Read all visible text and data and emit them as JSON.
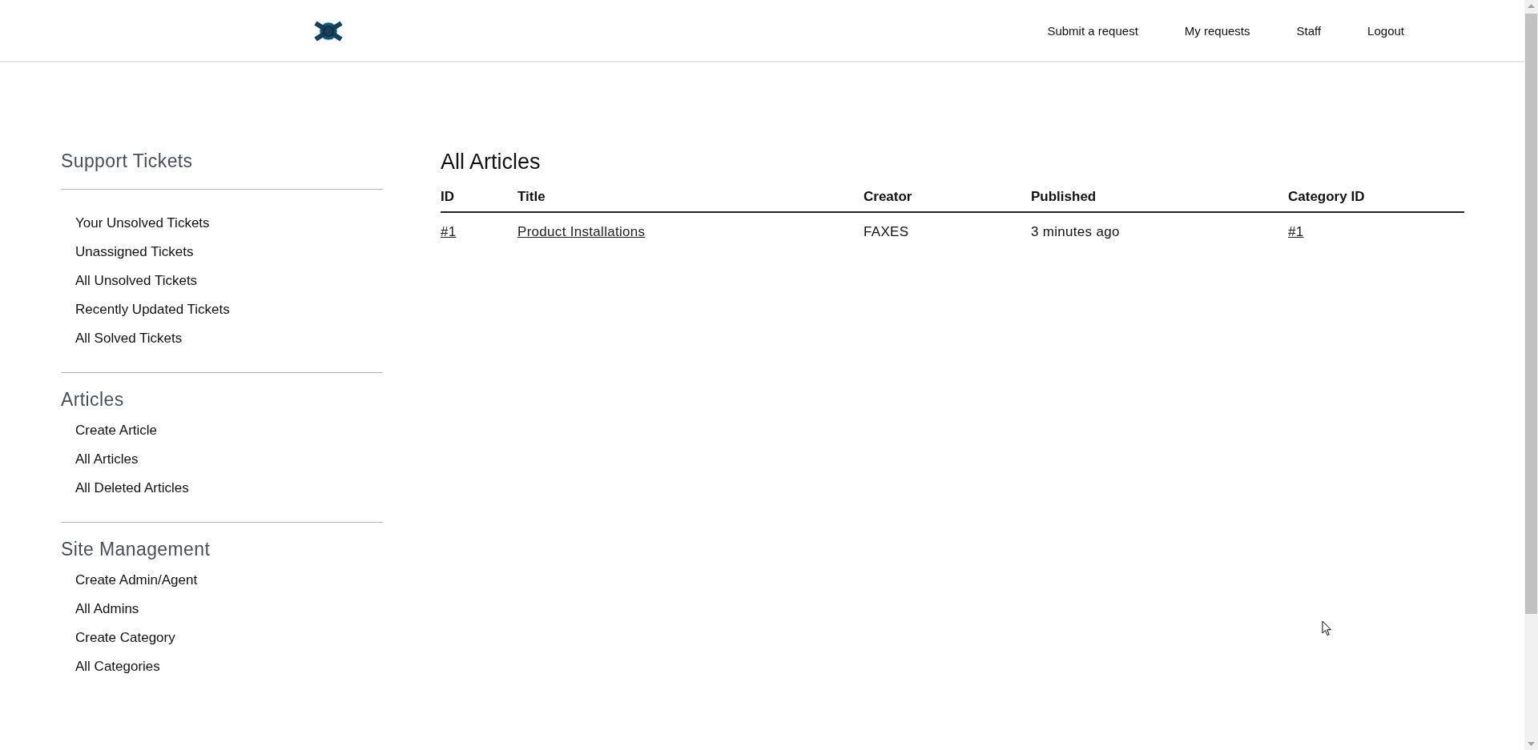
{
  "nav": [
    {
      "label": "Submit a request"
    },
    {
      "label": "My requests"
    },
    {
      "label": "Staff"
    },
    {
      "label": "Logout"
    }
  ],
  "sidebar": {
    "sections": [
      {
        "title": "Support Tickets",
        "items": [
          "Your Unsolved Tickets",
          "Unassigned Tickets",
          "All Unsolved Tickets",
          "Recently Updated Tickets",
          "All Solved Tickets"
        ]
      },
      {
        "title": "Articles",
        "items": [
          "Create Article",
          "All Articles",
          "All Deleted Articles"
        ]
      },
      {
        "title": "Site Management",
        "items": [
          "Create Admin/Agent",
          "All Admins",
          "Create Category",
          "All Categories"
        ]
      }
    ]
  },
  "main": {
    "title": "All Articles",
    "table": {
      "columns": [
        "ID",
        "Title",
        "Creator",
        "Published",
        "Category ID"
      ],
      "rows": [
        {
          "cells": [
            {
              "text": "#1",
              "kind": "link"
            },
            {
              "text": "Product Installations",
              "kind": "link"
            },
            {
              "text": "FAXES",
              "kind": "text"
            },
            {
              "text": "3 minutes ago",
              "kind": "text"
            },
            {
              "text": "#1",
              "kind": "link"
            }
          ]
        }
      ]
    }
  }
}
